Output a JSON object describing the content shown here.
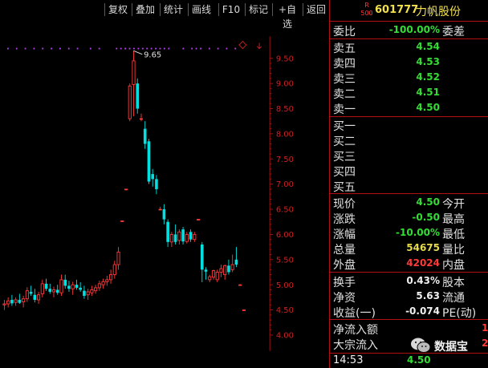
{
  "toolbar": {
    "buttons": [
      "复权",
      "叠加",
      "统计",
      "画线",
      "F10",
      "标记",
      "+自选",
      "返回"
    ]
  },
  "header": {
    "badge_top": "R",
    "badge_bottom": "500",
    "code": "601777",
    "name": "力帆股份"
  },
  "chart_data": {
    "type": "candlestick",
    "y_ticks": [
      "9.50",
      "9.00",
      "8.50",
      "8.00",
      "7.50",
      "7.00",
      "6.50",
      "6.00",
      "5.50",
      "5.00",
      "4.50",
      "4.00"
    ],
    "ylim": [
      4.0,
      9.72
    ],
    "max_label": "9.65",
    "candles": [
      {
        "o": 4.6,
        "h": 4.7,
        "l": 4.5,
        "c": 4.62
      },
      {
        "o": 4.62,
        "h": 4.75,
        "l": 4.55,
        "c": 4.68
      },
      {
        "o": 4.7,
        "h": 4.8,
        "l": 4.58,
        "c": 4.63
      },
      {
        "o": 4.65,
        "h": 4.75,
        "l": 4.58,
        "c": 4.7
      },
      {
        "o": 4.7,
        "h": 4.82,
        "l": 4.62,
        "c": 4.64
      },
      {
        "o": 4.66,
        "h": 4.78,
        "l": 4.55,
        "c": 4.72
      },
      {
        "o": 4.72,
        "h": 4.95,
        "l": 4.66,
        "c": 4.88
      },
      {
        "o": 4.86,
        "h": 4.98,
        "l": 4.78,
        "c": 4.82
      },
      {
        "o": 4.8,
        "h": 4.92,
        "l": 4.65,
        "c": 4.7
      },
      {
        "o": 4.7,
        "h": 4.86,
        "l": 4.62,
        "c": 4.8
      },
      {
        "o": 4.82,
        "h": 5.1,
        "l": 4.75,
        "c": 5.02
      },
      {
        "o": 5.02,
        "h": 5.12,
        "l": 4.88,
        "c": 4.92
      },
      {
        "o": 4.92,
        "h": 5.02,
        "l": 4.82,
        "c": 4.86
      },
      {
        "o": 4.86,
        "h": 4.96,
        "l": 4.75,
        "c": 4.9
      },
      {
        "o": 4.9,
        "h": 5.0,
        "l": 4.8,
        "c": 4.84
      },
      {
        "o": 4.84,
        "h": 5.2,
        "l": 4.78,
        "c": 5.1
      },
      {
        "o": 5.1,
        "h": 5.2,
        "l": 4.92,
        "c": 4.98
      },
      {
        "o": 4.98,
        "h": 5.08,
        "l": 4.86,
        "c": 4.92
      },
      {
        "o": 4.92,
        "h": 5.06,
        "l": 4.8,
        "c": 5.0
      },
      {
        "o": 5.0,
        "h": 5.1,
        "l": 4.9,
        "c": 4.94
      },
      {
        "o": 4.94,
        "h": 5.05,
        "l": 4.86,
        "c": 4.9
      },
      {
        "o": 4.88,
        "h": 4.98,
        "l": 4.72,
        "c": 4.78
      },
      {
        "o": 4.8,
        "h": 4.92,
        "l": 4.7,
        "c": 4.86
      },
      {
        "o": 4.84,
        "h": 4.98,
        "l": 4.78,
        "c": 4.9
      },
      {
        "o": 4.88,
        "h": 5.0,
        "l": 4.82,
        "c": 4.94
      },
      {
        "o": 4.94,
        "h": 5.08,
        "l": 4.88,
        "c": 5.02
      },
      {
        "o": 5.0,
        "h": 5.12,
        "l": 4.92,
        "c": 5.06
      },
      {
        "o": 5.06,
        "h": 5.18,
        "l": 4.98,
        "c": 5.1
      },
      {
        "o": 5.1,
        "h": 5.3,
        "l": 5.02,
        "c": 5.2
      },
      {
        "o": 5.2,
        "h": 5.48,
        "l": 5.12,
        "c": 5.4
      },
      {
        "o": 5.4,
        "h": 5.75,
        "l": 5.3,
        "c": 5.65
      },
      {
        "o": 6.27,
        "h": 6.27,
        "l": 6.27,
        "c": 6.27
      },
      {
        "o": 6.9,
        "h": 6.9,
        "l": 6.9,
        "c": 6.9
      },
      {
        "o": 8.3,
        "h": 9.0,
        "l": 8.25,
        "c": 8.95
      },
      {
        "o": 8.98,
        "h": 9.65,
        "l": 8.35,
        "c": 9.45
      },
      {
        "o": 9.0,
        "h": 9.1,
        "l": 8.4,
        "c": 8.5
      },
      {
        "o": 8.3,
        "h": 8.4,
        "l": 8.25,
        "c": 8.3
      },
      {
        "o": 8.1,
        "h": 8.25,
        "l": 7.7,
        "c": 7.8
      },
      {
        "o": 7.85,
        "h": 7.9,
        "l": 7.0,
        "c": 7.05
      },
      {
        "o": 7.2,
        "h": 7.3,
        "l": 6.95,
        "c": 7.1
      },
      {
        "o": 7.1,
        "h": 7.18,
        "l": 6.8,
        "c": 6.9
      },
      {
        "o": 6.5,
        "h": 6.55,
        "l": 6.5,
        "c": 6.5
      },
      {
        "o": 6.5,
        "h": 6.6,
        "l": 6.2,
        "c": 6.3
      },
      {
        "o": 6.25,
        "h": 6.3,
        "l": 5.75,
        "c": 5.85
      },
      {
        "o": 5.85,
        "h": 6.05,
        "l": 5.75,
        "c": 6.0
      },
      {
        "o": 6.0,
        "h": 6.2,
        "l": 5.8,
        "c": 5.85
      },
      {
        "o": 5.88,
        "h": 6.1,
        "l": 5.8,
        "c": 6.05
      },
      {
        "o": 6.1,
        "h": 6.15,
        "l": 5.8,
        "c": 5.86
      },
      {
        "o": 5.86,
        "h": 6.05,
        "l": 5.82,
        "c": 6.0
      },
      {
        "o": 6.05,
        "h": 6.1,
        "l": 5.85,
        "c": 5.9
      },
      {
        "o": 5.9,
        "h": 6.05,
        "l": 5.85,
        "c": 6.0
      },
      {
        "o": 6.3,
        "h": 6.3,
        "l": 6.3,
        "c": 6.3
      },
      {
        "o": 5.8,
        "h": 5.85,
        "l": 5.05,
        "c": 5.3
      },
      {
        "o": 5.3,
        "h": 5.35,
        "l": 5.1,
        "c": 5.26
      },
      {
        "o": 5.1,
        "h": 5.2,
        "l": 5.05,
        "c": 5.16
      },
      {
        "o": 5.15,
        "h": 5.3,
        "l": 5.1,
        "c": 5.28
      },
      {
        "o": 5.1,
        "h": 5.3,
        "l": 5.05,
        "c": 5.25
      },
      {
        "o": 5.25,
        "h": 5.4,
        "l": 5.15,
        "c": 5.32
      },
      {
        "o": 5.2,
        "h": 5.4,
        "l": 5.1,
        "c": 5.38
      },
      {
        "o": 5.38,
        "h": 5.5,
        "l": 5.2,
        "c": 5.25
      },
      {
        "o": 5.3,
        "h": 5.6,
        "l": 5.25,
        "c": 5.4
      },
      {
        "o": 5.5,
        "h": 5.75,
        "l": 5.35,
        "c": 5.4
      },
      {
        "o": 5.0,
        "h": 5.0,
        "l": 5.0,
        "c": 5.0
      },
      {
        "o": 4.5,
        "h": 4.5,
        "l": 4.5,
        "c": 4.5
      }
    ]
  },
  "panel": {
    "ratio": {
      "label": "委比",
      "value": "-100.00%",
      "label2": "委差"
    },
    "sells": [
      {
        "label": "卖五",
        "price": "4.54"
      },
      {
        "label": "卖四",
        "price": "4.53"
      },
      {
        "label": "卖三",
        "price": "4.52"
      },
      {
        "label": "卖二",
        "price": "4.51"
      },
      {
        "label": "卖一",
        "price": "4.50"
      }
    ],
    "buys": [
      {
        "label": "买一",
        "price": ""
      },
      {
        "label": "买二",
        "price": ""
      },
      {
        "label": "买三",
        "price": ""
      },
      {
        "label": "买四",
        "price": ""
      },
      {
        "label": "买五",
        "price": ""
      }
    ],
    "stats": [
      {
        "label": "现价",
        "value": "4.50",
        "color": "green",
        "label2": "今开"
      },
      {
        "label": "涨跌",
        "value": "-0.50",
        "color": "green",
        "label2": "最高"
      },
      {
        "label": "涨幅",
        "value": "-10.00%",
        "color": "green",
        "label2": "最低"
      },
      {
        "label": "总量",
        "value": "54675",
        "color": "yellow",
        "label2": "量比"
      },
      {
        "label": "外盘",
        "value": "42024",
        "color": "red",
        "label2": "内盘"
      }
    ],
    "stats2": [
      {
        "label": "换手",
        "value": "0.43%",
        "color": "white",
        "label2": "股本"
      },
      {
        "label": "净资",
        "value": "5.63",
        "color": "white",
        "label2": "流通"
      },
      {
        "label": "收益(一)",
        "value": "-0.074",
        "color": "white",
        "label2": "PE(动)"
      }
    ],
    "flows": [
      {
        "label": "净流入额",
        "value": "1"
      },
      {
        "label": "大宗流入",
        "value": "2"
      }
    ],
    "time": "14:53",
    "time_price": "4.50",
    "watermark": "数据宝"
  },
  "colors": {
    "up": "#ff3a3a",
    "down": "#00e0e0",
    "axis_red": "#b01010",
    "marker": "#c040ff"
  }
}
